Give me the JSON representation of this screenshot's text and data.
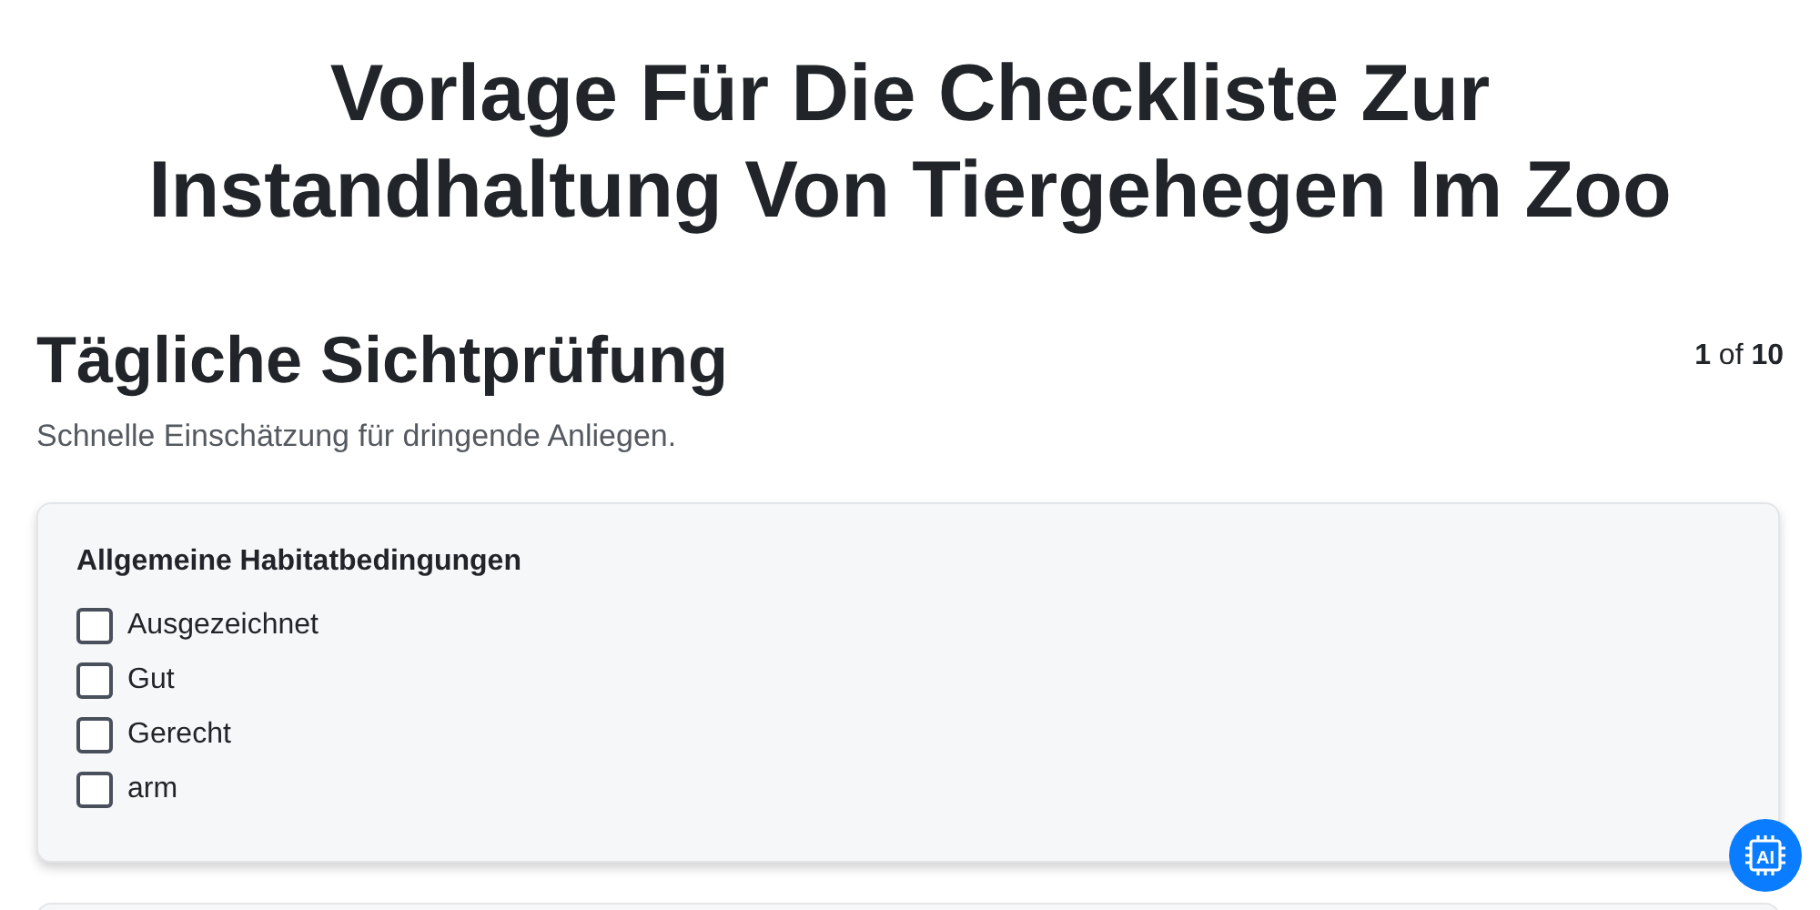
{
  "title": "Vorlage Für Die Checkliste Zur Instandhaltung Von Tiergehegen Im Zoo",
  "section": {
    "heading": "Tägliche Sichtprüfung",
    "pager": "**1** of **10**",
    "subtitle": "Schnelle Einschätzung für dringende Anliegen."
  },
  "questions": [
    {
      "label": "Allgemeine Habitatbedingungen",
      "options": [
        {
          "label": "Ausgezeichnet",
          "checked": false
        },
        {
          "label": "Gut",
          "checked": false
        },
        {
          "label": "Gerecht",
          "checked": false
        },
        {
          "label": "arm",
          "checked": false
        }
      ]
    }
  ],
  "ai_button": {
    "label": "AI"
  }
}
